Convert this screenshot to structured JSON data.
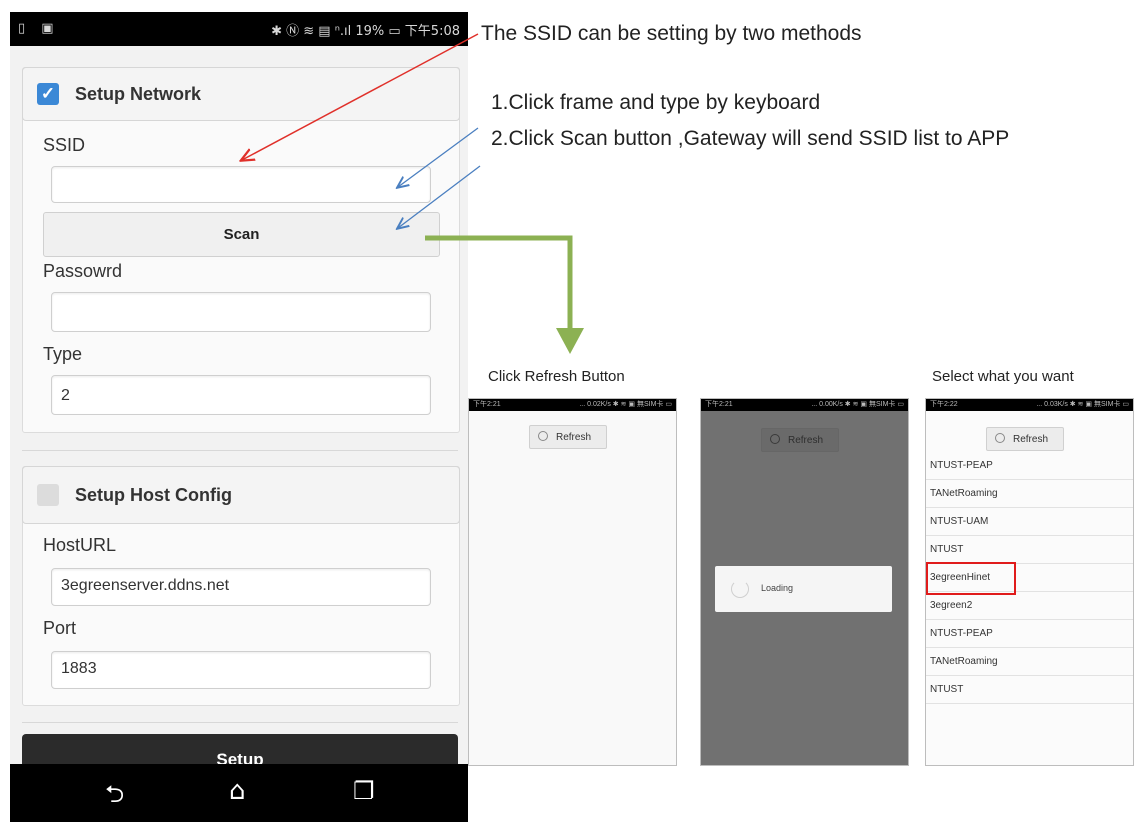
{
  "phone": {
    "status_left_icons": "▯ ▣",
    "status_right": "✱ Ⓝ ≋ ▤ ⁿ.ıl 19% ▭ 下午5:08",
    "network": {
      "header_label": "Setup Network",
      "checked": true,
      "ssid_label": "SSID",
      "ssid_value": "",
      "scan_label": "Scan",
      "password_label": "Passowrd",
      "password_value": "",
      "type_label": "Type",
      "type_value": "2"
    },
    "host": {
      "header_label": "Setup Host Config",
      "checked": false,
      "url_label": "HostURL",
      "url_value": "3egreenserver.ddns.net",
      "port_label": "Port",
      "port_value": "1883"
    },
    "setup_label": "Setup",
    "nav": {
      "back": "⮌",
      "home": "⌂",
      "recent": "❐"
    }
  },
  "annotations": {
    "line1": "The SSID can be setting by two methods",
    "line2": "1.Click frame and type by keyboard",
    "line3": "2.Click Scan button ,Gateway will send SSID list to APP"
  },
  "screens": {
    "caption_refresh": "Click Refresh Button",
    "caption_select": "Select what you want",
    "s1": {
      "time": "下午2:21",
      "status": "... 0.02K/s ✱ ≋ ▣ 無SIM卡 ▭",
      "refresh_label": "Refresh"
    },
    "s2": {
      "time": "下午2:21",
      "status": "... 0.00K/s ✱ ≋ ▣ 無SIM卡 ▭",
      "refresh_label": "Refresh",
      "loading_label": "Loading"
    },
    "s3": {
      "time": "下午2:22",
      "status": "... 0.03K/s ✱ ≋ ▣ 無SIM卡 ▭",
      "refresh_label": "Refresh",
      "items": [
        "NTUST-PEAP",
        "TANetRoaming",
        "NTUST-UAM",
        "NTUST",
        "3egreenHinet",
        "3egreen2",
        "NTUST-PEAP",
        "TANetRoaming",
        "NTUST"
      ],
      "highlighted_index": 4
    }
  },
  "colors": {
    "checkbox_on": "#3b88d6",
    "red_arrow": "#e0302a",
    "blue_arrow": "#4a7fc0",
    "green_arrow": "#8cb153",
    "highlight_box": "#e01b1b"
  }
}
